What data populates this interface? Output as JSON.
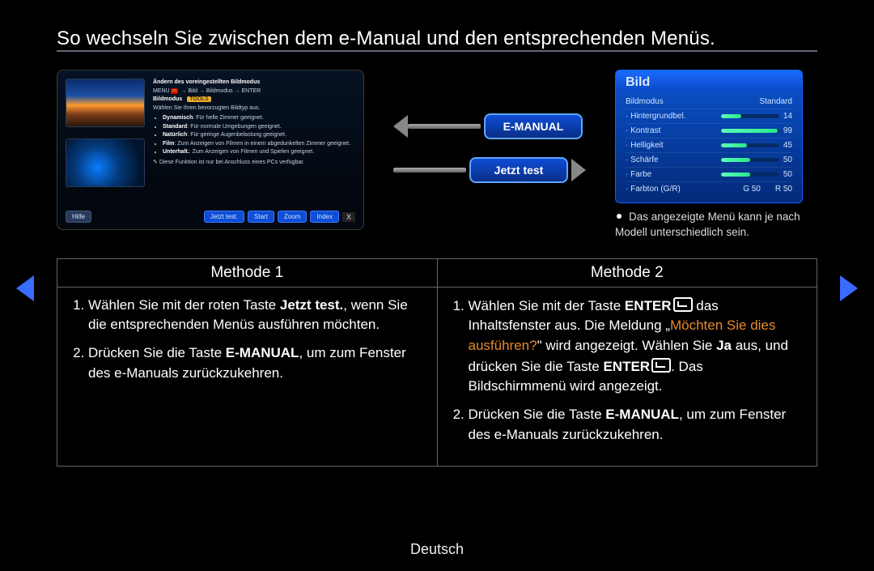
{
  "title": "So wechseln Sie zwischen dem e-Manual und den entsprechenden Menüs.",
  "footer_lang": "Deutsch",
  "center_pills": {
    "emanual": "E-MANUAL",
    "jetzt": "Jetzt test"
  },
  "emanual_panel": {
    "heading": "Ändern des voreingestellten Bildmodus",
    "path_menu": "MENU",
    "path_rest": " → Bild → Bildmodus → ENTER",
    "mode_label": "Bildmodus",
    "mode_badge": "TOOLS",
    "instruction": "Wählen Sie Ihren bevorzugten Bildtyp aus.",
    "items": [
      {
        "name": "Dynamisch",
        "desc": "Für helle Zimmer geeignet."
      },
      {
        "name": "Standard",
        "desc": "Für normale Umgebungen geeignet."
      },
      {
        "name": "Natürlich",
        "desc": "Für geringe Augenbelastung geeignet."
      },
      {
        "name": "Film",
        "desc": "Zum Anzeigen von Filmen in einem abgedunkelten Zimmer geeignet."
      },
      {
        "name": "Unterhalt.",
        "desc": "Zum Anzeigen von Filmen und Spielen geeignet."
      }
    ],
    "footnote": "Diese Funktion ist nur bei Anschluss eines PCs verfügbar.",
    "footer_buttons": {
      "hilfe": "Hilfe",
      "jetzt_test": "Jetzt test.",
      "start": "Start",
      "zoom": "Zoom",
      "index": "Index"
    }
  },
  "osd": {
    "title": "Bild",
    "rows": [
      {
        "label": "Bildmodus",
        "value": "Standard",
        "type": "text",
        "first": true
      },
      {
        "label": "Hintergrundbel.",
        "value": "14",
        "type": "slider",
        "pct": 35
      },
      {
        "label": "Kontrast",
        "value": "99",
        "type": "slider",
        "pct": 98
      },
      {
        "label": "Helligkeit",
        "value": "45",
        "type": "slider",
        "pct": 45
      },
      {
        "label": "Schärfe",
        "value": "50",
        "type": "slider",
        "pct": 50
      },
      {
        "label": "Farbe",
        "value": "50",
        "type": "slider",
        "pct": 50
      }
    ],
    "tint_row": {
      "label": "Farbton (G/R)",
      "g": "G 50",
      "r": "R 50"
    },
    "note": "Das angezeigte Menü kann je nach Modell unterschiedlich sein."
  },
  "methods": {
    "h1": "Methode 1",
    "h2": "Methode 2",
    "m1": {
      "s1_a": "Wählen Sie mit der roten Taste ",
      "s1_b": "Jetzt test.",
      "s1_c": ", wenn Sie die entsprechenden Menüs ausführen möchten.",
      "s2_a": "Drücken Sie die Taste ",
      "s2_b": "E-MANUAL",
      "s2_c": ", um zum Fenster des e-Manuals zurückzukehren."
    },
    "m2": {
      "s1_a": "Wählen Sie mit der Taste ",
      "s1_enter": "ENTER",
      "s1_b": " das Inhaltsfenster aus. Die Meldung „",
      "s1_c": "Möchten Sie dies ausführen?",
      "s1_d": "\" wird angezeigt. Wählen Sie ",
      "s1_e": "Ja",
      "s1_f": " aus, und drücken Sie die Taste ",
      "s1_g": ". Das Bildschirmmenü wird angezeigt.",
      "s2_a": "Drücken Sie die Taste ",
      "s2_b": "E-MANUAL",
      "s2_c": ", um zum Fenster des e-Manuals zurückzukehren."
    }
  }
}
